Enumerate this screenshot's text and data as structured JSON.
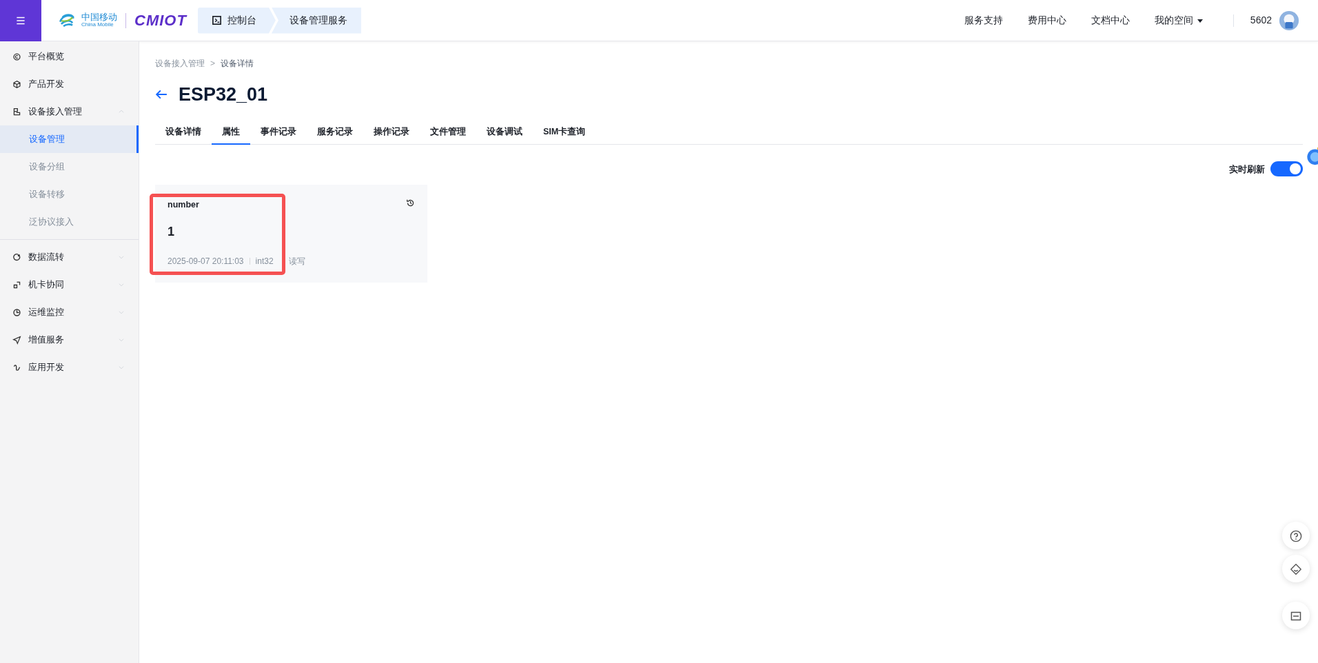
{
  "topbar": {
    "logo": {
      "cn": "中国移动",
      "en": "China Mobile",
      "brand": "CMIOT"
    },
    "breadcrumbs": [
      {
        "label": "控制台"
      },
      {
        "label": "设备管理服务"
      }
    ],
    "nav": [
      {
        "label": "服务支持",
        "dropdown": false
      },
      {
        "label": "费用中心",
        "dropdown": false
      },
      {
        "label": "文档中心",
        "dropdown": false
      },
      {
        "label": "我的空间",
        "dropdown": true
      }
    ],
    "user": "5602"
  },
  "sidebar": {
    "items": [
      {
        "label": "平台概览"
      },
      {
        "label": "产品开发"
      },
      {
        "label": "设备接入管理",
        "expanded": true,
        "children": [
          {
            "label": "设备管理",
            "selected": true
          },
          {
            "label": "设备分组",
            "selected": false
          },
          {
            "label": "设备转移",
            "selected": false
          },
          {
            "label": "泛协议接入",
            "selected": false
          }
        ]
      },
      {
        "label": "数据流转",
        "expanded": false
      },
      {
        "label": "机卡协同",
        "expanded": false
      },
      {
        "label": "运维监控",
        "expanded": false
      },
      {
        "label": "增值服务",
        "expanded": false
      },
      {
        "label": "应用开发",
        "expanded": false
      }
    ]
  },
  "breadcrumb": {
    "items": [
      "设备接入管理",
      "设备详情"
    ],
    "separator": ">"
  },
  "title": "ESP32_01",
  "tabs": [
    {
      "label": "设备详情",
      "selected": false
    },
    {
      "label": "属性",
      "selected": true
    },
    {
      "label": "事件记录",
      "selected": false
    },
    {
      "label": "服务记录",
      "selected": false
    },
    {
      "label": "操作记录",
      "selected": false
    },
    {
      "label": "文件管理",
      "selected": false
    },
    {
      "label": "设备调试",
      "selected": false
    },
    {
      "label": "SIM卡查询",
      "selected": false
    }
  ],
  "realtime_refresh": {
    "label": "实时刷新",
    "on": true
  },
  "properties": [
    {
      "name": "number",
      "value": "1",
      "time": "2025-09-07 20:11:03",
      "type": "int32",
      "access": "读写",
      "highlighted": true
    }
  ]
}
